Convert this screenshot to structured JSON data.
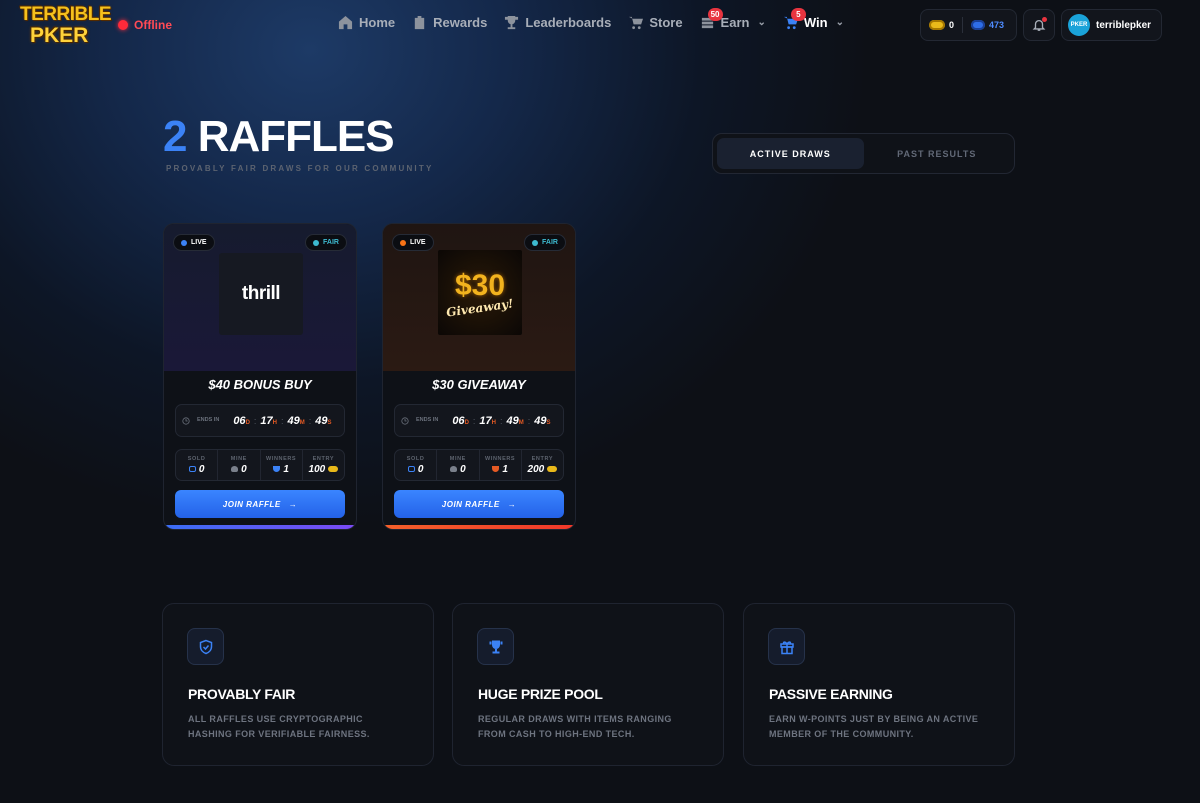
{
  "nav": {
    "logo_line1": "TERRIBLE",
    "logo_line2": "PKER",
    "status": "Offline",
    "items": [
      {
        "label": "Home",
        "icon": "home-icon"
      },
      {
        "label": "Rewards",
        "icon": "rewards-icon"
      },
      {
        "label": "Leaderboards",
        "icon": "trophy-icon"
      },
      {
        "label": "Store",
        "icon": "cart-icon"
      },
      {
        "label": "Earn",
        "icon": "coins-icon",
        "badge": "50"
      },
      {
        "label": "Win",
        "icon": "win-cart-icon",
        "badge": "5"
      }
    ],
    "coins": "0",
    "points": "473",
    "username": "terriblepker",
    "avatar_text": "PKER"
  },
  "hero": {
    "count": "2",
    "title": "RAFFLES",
    "subtitle": "PROVABLY FAIR DRAWS FOR OUR COMMUNITY"
  },
  "tabs": {
    "active": "ACTIVE DRAWS",
    "inactive": "PAST RESULTS"
  },
  "raffles": [
    {
      "live_label": "LIVE",
      "live_color": "#3b82f6",
      "fair_label": "FAIR",
      "image_text": "thrill",
      "title": "$40 BONUS BUY",
      "ends_label": "ENDS IN",
      "days": "06",
      "hours": "17",
      "minutes": "49",
      "seconds": "49",
      "d_unit": "D",
      "h_unit": "H",
      "m_unit": "M",
      "s_unit": "S",
      "sold_label": "SOLD",
      "sold": "0",
      "mine_label": "MINE",
      "mine": "0",
      "winners_label": "WINNERS",
      "winners": "1",
      "entry_label": "ENTRY",
      "entry": "100",
      "button": "JOIN RAFFLE"
    },
    {
      "live_label": "LIVE",
      "live_color": "#f97316",
      "fair_label": "FAIR",
      "image_big": "$30",
      "image_small": "Giveaway!",
      "title": "$30 GIVEAWAY",
      "ends_label": "ENDS IN",
      "days": "06",
      "hours": "17",
      "minutes": "49",
      "seconds": "49",
      "d_unit": "D",
      "h_unit": "H",
      "m_unit": "M",
      "s_unit": "S",
      "sold_label": "SOLD",
      "sold": "0",
      "mine_label": "MINE",
      "mine": "0",
      "winners_label": "WINNERS",
      "winners": "1",
      "entry_label": "ENTRY",
      "entry": "200",
      "button": "JOIN RAFFLE"
    }
  ],
  "features": [
    {
      "icon": "shield-icon",
      "title": "PROVABLY FAIR",
      "desc": "ALL RAFFLES USE CRYPTOGRAPHIC HASHING FOR VERIFIABLE FAIRNESS."
    },
    {
      "icon": "trophy-icon",
      "title": "HUGE PRIZE POOL",
      "desc": "REGULAR DRAWS WITH ITEMS RANGING FROM CASH TO HIGH-END TECH."
    },
    {
      "icon": "gift-icon",
      "title": "PASSIVE EARNING",
      "desc": "EARN W-POINTS JUST BY BEING AN ACTIVE MEMBER OF THE COMMUNITY."
    }
  ]
}
